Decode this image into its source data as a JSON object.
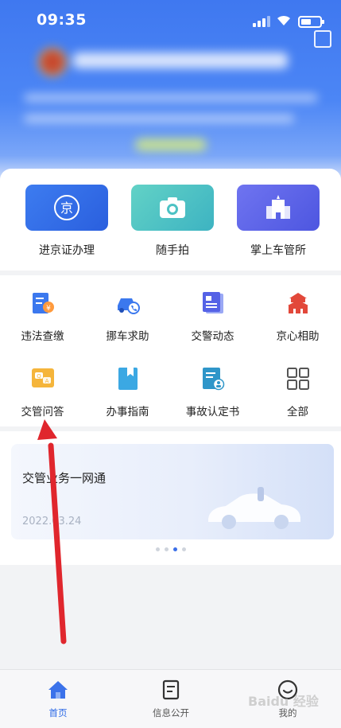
{
  "status_bar": {
    "time": "09:35"
  },
  "quick_actions": [
    {
      "label": "进京证办理",
      "icon": "jing-badge-icon"
    },
    {
      "label": "随手拍",
      "icon": "camera-icon"
    },
    {
      "label": "掌上车管所",
      "icon": "building-icon"
    }
  ],
  "services": [
    {
      "label": "违法查缴",
      "icon": "violation-payment-icon"
    },
    {
      "label": "挪车求助",
      "icon": "move-car-call-icon"
    },
    {
      "label": "交警动态",
      "icon": "news-icon"
    },
    {
      "label": "京心相助",
      "icon": "tiananmen-icon"
    },
    {
      "label": "交管问答",
      "icon": "qa-chat-icon"
    },
    {
      "label": "办事指南",
      "icon": "guide-book-icon"
    },
    {
      "label": "事故认定书",
      "icon": "accident-document-icon"
    },
    {
      "label": "全部",
      "icon": "grid-all-icon"
    }
  ],
  "promo": {
    "title": "交管业务一网通",
    "date": "2022.03.24",
    "active_dot": 3,
    "dot_count": 4
  },
  "tabs": [
    {
      "label": "首页",
      "icon": "home-icon",
      "active": true
    },
    {
      "label": "信息公开",
      "icon": "document-icon",
      "active": false
    },
    {
      "label": "我的",
      "icon": "smile-user-icon",
      "active": false
    }
  ],
  "colors": {
    "accent": "#2f6be6",
    "header": "#4680f3",
    "arrow": "#e0262d"
  },
  "watermark": "Baidu 经验"
}
